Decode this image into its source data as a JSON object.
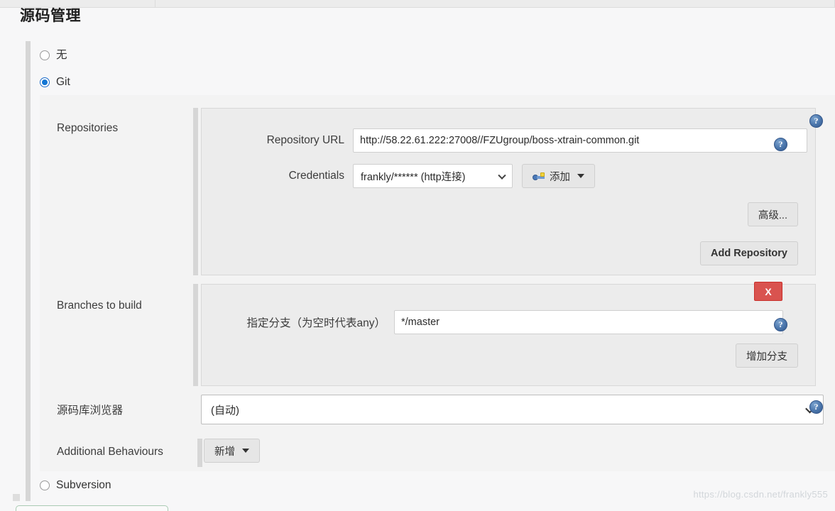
{
  "page": {
    "title": "源码管理",
    "watermark": "https://blog.csdn.net/frankly555"
  },
  "scm_type": {
    "options": [
      {
        "label": "无",
        "selected": false
      },
      {
        "label": "Git",
        "selected": true
      },
      {
        "label": "Subversion",
        "selected": false
      }
    ]
  },
  "git": {
    "repositories": {
      "section_label": "Repositories",
      "repository_url": {
        "label": "Repository URL",
        "value": "http://58.22.61.222:27008//FZUgroup/boss-xtrain-common.git",
        "placeholder": ""
      },
      "credentials": {
        "label": "Credentials",
        "value": "frankly/****** (http连接)",
        "add_button": "添加"
      },
      "advanced_button": "高级...",
      "add_repository_button": "Add Repository"
    },
    "branches": {
      "section_label": "Branches to build",
      "branch_specifier": {
        "label": "指定分支（为空时代表any）",
        "value": "*/master",
        "placeholder": ""
      },
      "delete_button": "X",
      "add_branch_button": "增加分支"
    },
    "repository_browser": {
      "label": "源码库浏览器",
      "value": "(自动)"
    },
    "additional_behaviours": {
      "label": "Additional Behaviours",
      "add_button": "新增"
    }
  },
  "help": {
    "glyph": "?"
  },
  "colors": {
    "accent_blue": "#1276d4",
    "danger_red": "#d9534f",
    "help_blue": "#4a75ab",
    "panel_bg": "#ececec",
    "page_bg": "#f7f7f8"
  }
}
